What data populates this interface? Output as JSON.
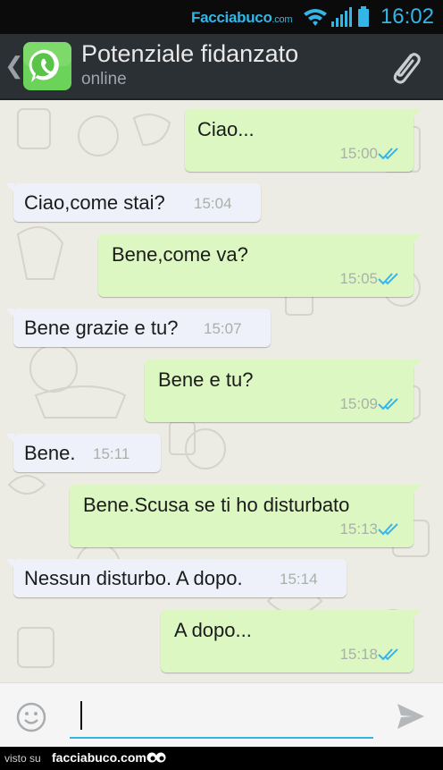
{
  "status_bar": {
    "brand_main": "Facciabuco",
    "brand_tld": ".com",
    "time": "16:02",
    "icons": [
      "wifi-icon",
      "signal-icon",
      "battery-icon"
    ]
  },
  "header": {
    "back_glyph": "❮",
    "contact_name": "Potenziale fidanzato",
    "presence": "online",
    "logo_icon": "whatsapp-logo",
    "action_icon": "paperclip-icon"
  },
  "messages": [
    {
      "direction": "out",
      "text": "Ciao...",
      "time": "15:00",
      "read": true
    },
    {
      "direction": "in",
      "text": "Ciao,come stai?",
      "time": "15:04"
    },
    {
      "direction": "out",
      "text": "Bene,come va?",
      "time": "15:05",
      "read": true
    },
    {
      "direction": "in",
      "text": "Bene grazie e tu?",
      "time": "15:07"
    },
    {
      "direction": "out",
      "text": "Bene e tu?",
      "time": "15:09",
      "read": true
    },
    {
      "direction": "in",
      "text": "Bene.",
      "time": "15:11"
    },
    {
      "direction": "out",
      "text": "Bene.Scusa se ti ho disturbato",
      "time": "15:13",
      "read": true
    },
    {
      "direction": "in",
      "text": "Nessun disturbo. A dopo.",
      "time": "15:14"
    },
    {
      "direction": "out",
      "text": "A dopo...",
      "time": "15:18",
      "read": true
    }
  ],
  "composer": {
    "input_value": "",
    "emoji_icon": "smiley-icon",
    "send_icon": "send-icon"
  },
  "footer": {
    "visto_label": "visto su",
    "site": "facciabuco.com"
  },
  "colors": {
    "accent": "#33b5e5",
    "outgoing_bubble": "#dcf7c2",
    "incoming_bubble": "#eef1f9",
    "read_ticks": "#34b7f1",
    "header_bg": "#2b3034",
    "chat_bg": "#ecebe4"
  }
}
